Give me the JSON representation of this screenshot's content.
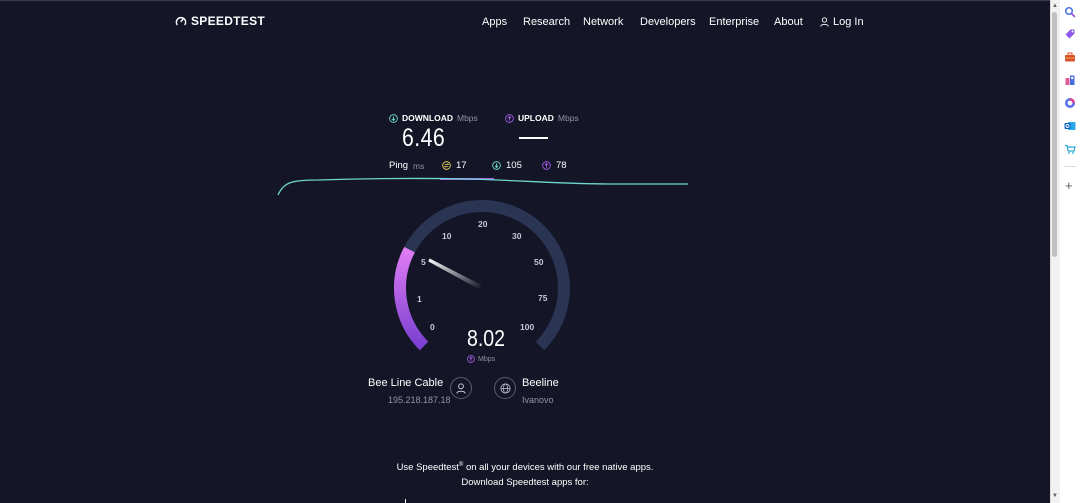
{
  "brand": {
    "logo_text": "SPEEDTEST"
  },
  "nav": {
    "items": [
      "Apps",
      "Research",
      "Network",
      "Developers",
      "Enterprise",
      "About"
    ],
    "login_label": "Log In"
  },
  "download": {
    "label": "DOWNLOAD",
    "unit": "Mbps",
    "value": "6.46"
  },
  "upload": {
    "label": "UPLOAD",
    "unit": "Mbps",
    "value": ""
  },
  "ping": {
    "label": "Ping",
    "unit": "ms",
    "idle": "17",
    "download": "105",
    "upload": "78"
  },
  "gauge": {
    "ticks": [
      "0",
      "1",
      "5",
      "10",
      "20",
      "30",
      "50",
      "75",
      "100"
    ],
    "current_value": "8.02",
    "unit": "Mbps",
    "fraction": 0.27
  },
  "isp": {
    "name": "Bee Line Cable",
    "ip": "195.218.187.18"
  },
  "server": {
    "name": "Beeline",
    "city": "Ivanovo"
  },
  "promo": {
    "line1_prefix": "Use Speedtest",
    "line1_mark": "®",
    "line1_suffix": " on all your devices with our free native apps.",
    "line2": "Download Speedtest apps for:"
  },
  "colors": {
    "background": "#141526",
    "download_accent": "#6fd6cf",
    "upload_accent": "#a25ce6",
    "ping_accent": "#e8d25a",
    "gauge_track": "#2a3453",
    "gauge_fill": "#b85cf0"
  },
  "edge_sidebar": {
    "icons": [
      "search-icon",
      "tag-icon",
      "toolbox-icon",
      "games-icon",
      "office-icon",
      "outlook-icon",
      "shopping-icon",
      "add-icon"
    ]
  }
}
